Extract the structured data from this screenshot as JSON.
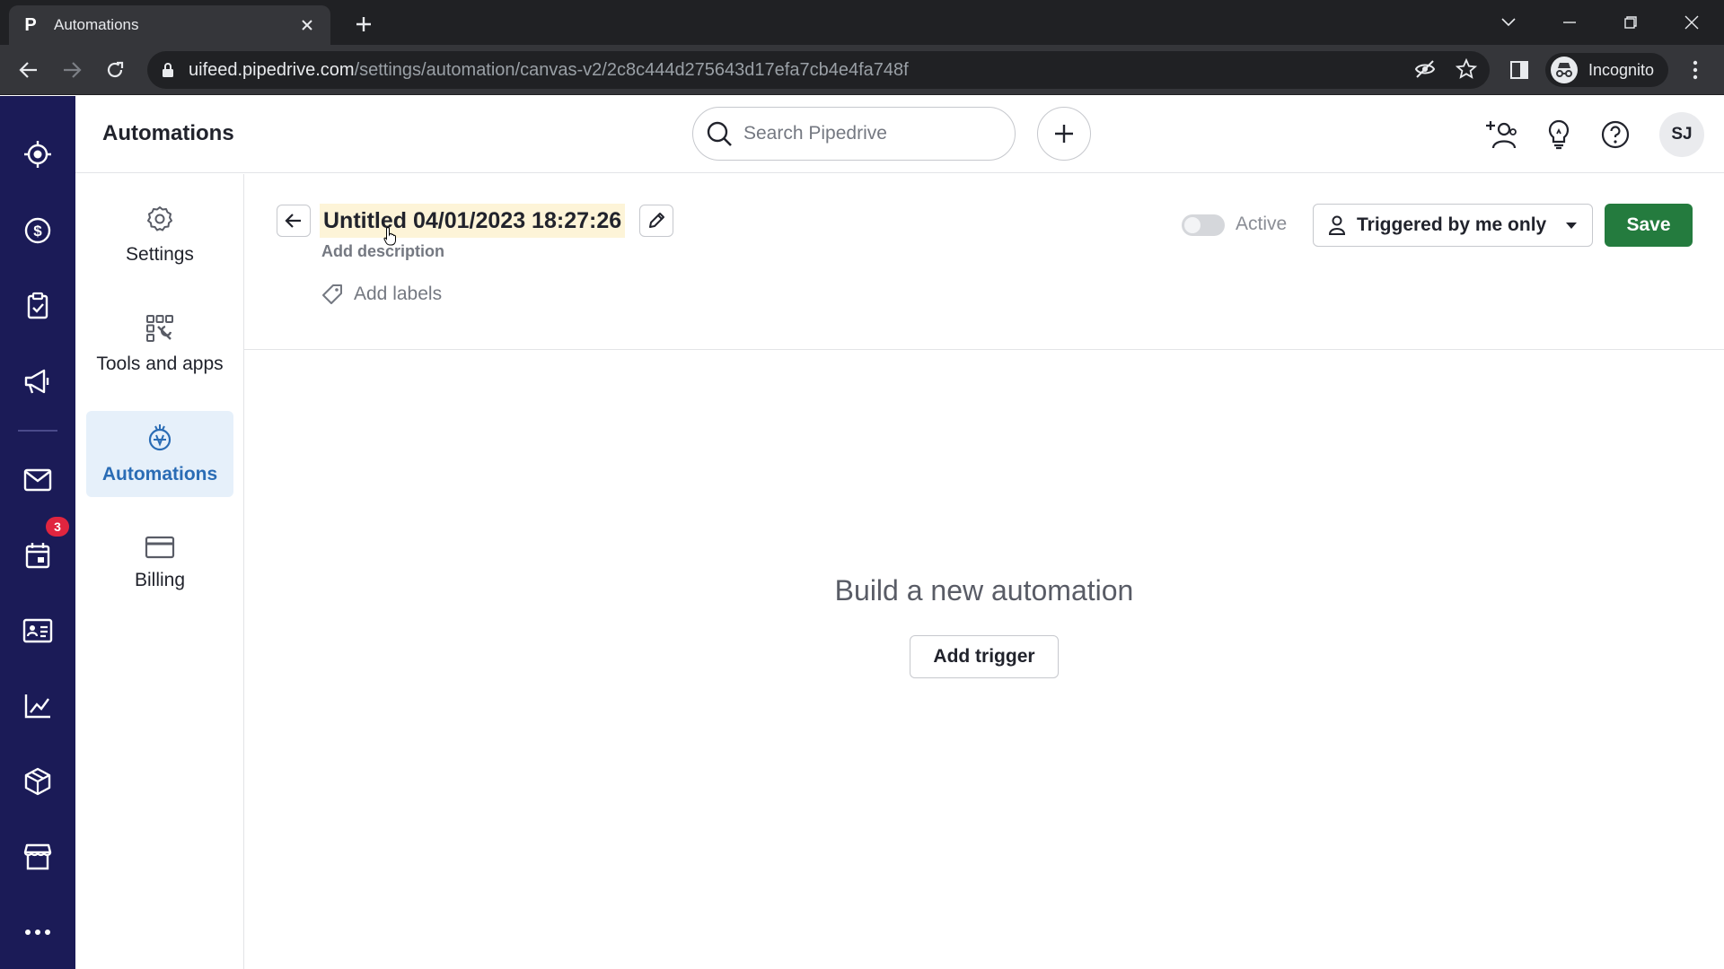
{
  "browser": {
    "tab_title": "Automations",
    "tab_favicon": "P",
    "url_host": "uifeed.pipedrive.com",
    "url_path": "/settings/automation/canvas-v2/2c8c444d275643d17efa7cb4e4fa748f",
    "profile_label": "Incognito"
  },
  "header": {
    "title": "Automations",
    "search_placeholder": "Search Pipedrive",
    "user_initials": "SJ"
  },
  "leftnav": {
    "badge_count": "3",
    "icons": [
      "focus-icon",
      "deals-icon",
      "activities-icon",
      "campaigns-icon",
      "mail-icon",
      "calendar-icon",
      "contacts-icon",
      "insights-icon",
      "products-icon",
      "marketplace-icon",
      "more-icon"
    ]
  },
  "settings_sidebar": {
    "items": [
      {
        "label": "Settings",
        "icon": "gear-icon"
      },
      {
        "label": "Tools and apps",
        "icon": "tools-icon"
      },
      {
        "label": "Automations",
        "icon": "automation-icon",
        "active": true
      },
      {
        "label": "Billing",
        "icon": "card-icon"
      }
    ]
  },
  "automation": {
    "title": "Untitled 04/01/2023 18:27:26",
    "add_description": "Add description",
    "add_labels": "Add labels",
    "active_label": "Active",
    "active": false,
    "trigger_option": "Triggered by me only",
    "save_label": "Save"
  },
  "empty_state": {
    "title": "Build a new automation",
    "add_trigger_label": "Add trigger"
  }
}
